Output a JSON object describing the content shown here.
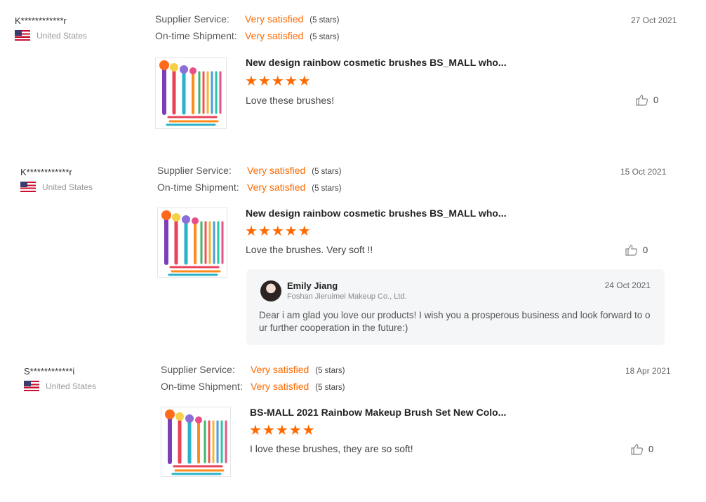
{
  "colors": {
    "accent": "#ff6a00",
    "reply_bg": "#f5f6f7"
  },
  "labels": {
    "supplier": "Supplier Service:",
    "shipment": "On-time Shipment:"
  },
  "reviews": [
    {
      "user": "K************r",
      "country": "United States",
      "date": "27 Oct 2021",
      "supplier_value": "Very satisfied",
      "supplier_stars": "(5 stars)",
      "shipment_value": "Very satisfied",
      "shipment_stars": "(5 stars)",
      "product_title": "New design rainbow cosmetic brushes BS_MALL who...",
      "rating": 5,
      "stars": "★★★★★",
      "comment": "Love these brushes!",
      "likes": "0"
    },
    {
      "user": "K************r",
      "country": "United States",
      "date": "15 Oct 2021",
      "supplier_value": "Very satisfied",
      "supplier_stars": "(5 stars)",
      "shipment_value": "Very satisfied",
      "shipment_stars": "(5 stars)",
      "product_title": "New design rainbow cosmetic brushes BS_MALL who...",
      "rating": 5,
      "stars": "★★★★★",
      "comment": "Love the brushes. Very soft !!",
      "likes": "0",
      "reply": {
        "name": "Emily Jiang",
        "company": "Foshan Jieruimei Makeup Co., Ltd.",
        "date": "24 Oct 2021",
        "text": "Dear i am glad you love our products! I wish you a prosperous business and look forward to our further cooperation in the future:)"
      }
    },
    {
      "user": "S************i",
      "country": "United States",
      "date": "18 Apr 2021",
      "supplier_value": "Very satisfied",
      "supplier_stars": "(5 stars)",
      "shipment_value": "Very satisfied",
      "shipment_stars": "(5 stars)",
      "product_title": "BS-MALL 2021 Rainbow Makeup Brush Set New Colo...",
      "rating": 5,
      "stars": "★★★★★",
      "comment": "I love these brushes, they are so soft!",
      "likes": "0"
    }
  ]
}
